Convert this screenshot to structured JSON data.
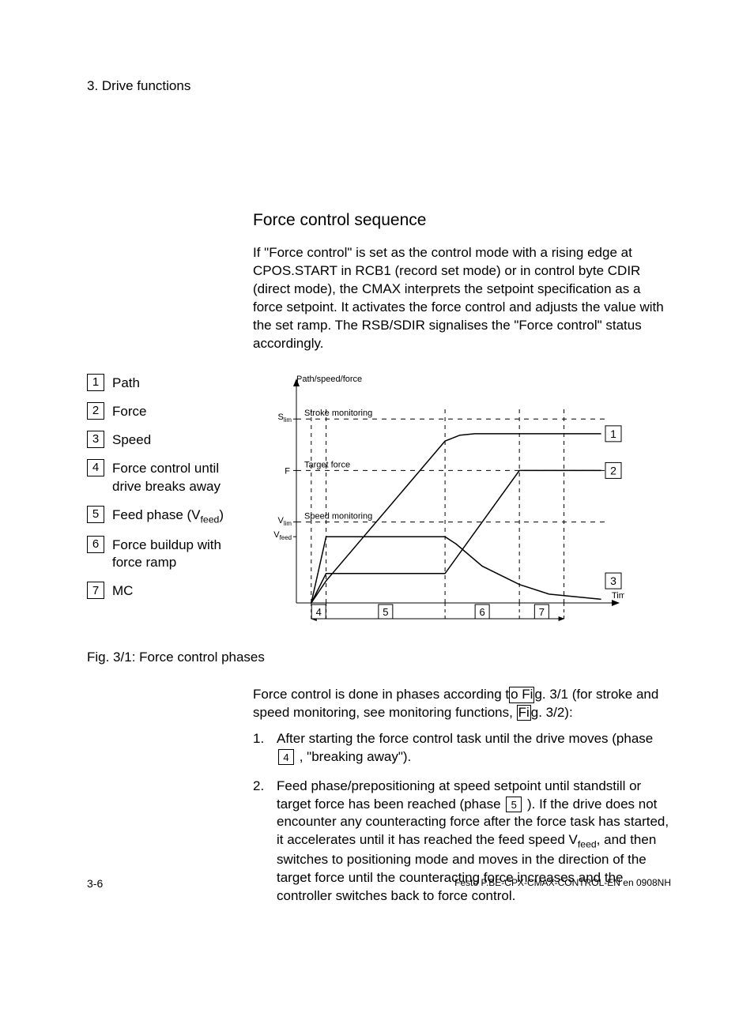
{
  "chapter": "3.  Drive functions",
  "section_heading": "Force control sequence",
  "intro_para": "If \"Force control\" is set as the control mode with a rising edge at CPOS.START in RCB1 (record set mode) or in control byte CDIR (direct mode), the CMAX interprets the setpoint specification as a force setpoint. It activates the force control and adjusts the value with the set ramp. The RSB/SDIR signalises the \"Force control\" status accordingly.",
  "legend": {
    "items": [
      {
        "num": "1",
        "text": "Path"
      },
      {
        "num": "2",
        "text": "Force"
      },
      {
        "num": "3",
        "text": "Speed"
      },
      {
        "num": "4",
        "text": "Force control until drive breaks away"
      },
      {
        "num": "5",
        "text_html": "Feed phase (V<sub>feed</sub>)"
      },
      {
        "num": "6",
        "text": "Force buildup with force ramp"
      },
      {
        "num": "7",
        "text": "MC"
      }
    ]
  },
  "chart_data": {
    "type": "line",
    "title": "Path/speed/force",
    "xlabel": "Time",
    "ylabel": "",
    "y_ticks": [
      {
        "label_html": "S<sub>lim</sub>",
        "value": 250
      },
      {
        "label": "F",
        "value": 180
      },
      {
        "label_html": "V<sub>lim</sub>",
        "value": 110
      },
      {
        "label_html": "V<sub>feed</sub>",
        "value": 90
      }
    ],
    "dashed_lines_y": [
      {
        "label": "Stroke monitoring",
        "y": 250
      },
      {
        "label": "Target force",
        "y": 180
      },
      {
        "label": "Speed monitoring",
        "y": 110
      }
    ],
    "phase_boundaries_x": [
      20,
      40,
      200,
      300,
      360
    ],
    "phase_labels_x": [
      {
        "num": "4",
        "x": 30
      },
      {
        "num": "5",
        "x": 120
      },
      {
        "num": "6",
        "x": 250
      },
      {
        "num": "7",
        "x": 330
      }
    ],
    "curve_markers": [
      {
        "num": "1",
        "side": "right",
        "y": 230
      },
      {
        "num": "2",
        "side": "right",
        "y": 180
      },
      {
        "num": "3",
        "side": "right",
        "y": 30
      }
    ],
    "series": [
      {
        "name": "Path",
        "points": [
          [
            20,
            0
          ],
          [
            40,
            30
          ],
          [
            200,
            220
          ],
          [
            220,
            228
          ],
          [
            240,
            230
          ],
          [
            410,
            230
          ]
        ]
      },
      {
        "name": "Force",
        "points": [
          [
            20,
            0
          ],
          [
            40,
            40
          ],
          [
            200,
            40
          ],
          [
            300,
            180
          ],
          [
            410,
            180
          ]
        ]
      },
      {
        "name": "Speed",
        "points": [
          [
            20,
            0
          ],
          [
            40,
            90
          ],
          [
            200,
            90
          ],
          [
            215,
            80
          ],
          [
            250,
            50
          ],
          [
            300,
            25
          ],
          [
            340,
            12
          ],
          [
            410,
            5
          ]
        ]
      }
    ],
    "xlim": [
      0,
      420
    ],
    "ylim": [
      0,
      290
    ]
  },
  "fig_caption": "Fig. 3/1:   Force control phases",
  "phase_intro_parts": {
    "a": "Force control is done in phases according t",
    "ref1": "o Fi",
    "b": "g. 3/1 (for stroke and speed monitoring, see monitoring functions, ",
    "ref2": "Fi",
    "c": "g. 3/2):"
  },
  "num_list": [
    {
      "num": "1.",
      "parts": {
        "a": "After starting the force control task until the drive moves (phase ",
        "box": "4",
        "b": " , \"breaking away\")."
      }
    },
    {
      "num": "2.",
      "parts": {
        "a": "Feed phase/prepositioning at speed setpoint until standstill or target force has been reached (phase ",
        "box": "5",
        "b": " ). If the drive does not encounter any counteracting force after the force task has started, it accelerates until it has reached the feed speed V",
        "sub": "feed",
        "c": ", and then switches to positioning mode and moves in the direction of the target force until the counteracting force increases and the controller switches back to force control."
      }
    }
  ],
  "footer": {
    "left": "3-6",
    "right": "Festo  P.BE-CPX-CMAX-CONTROL-EN  en 0908NH"
  }
}
